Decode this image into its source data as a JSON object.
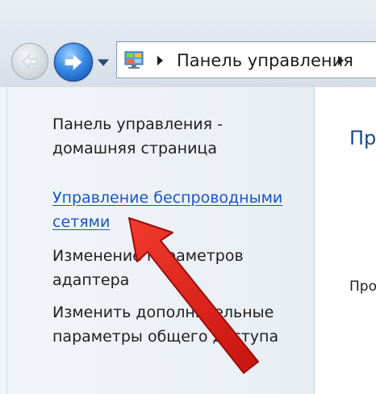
{
  "address_bar": {
    "breadcrumb": "Панель управления",
    "icon": "control-panel-icon"
  },
  "navigation": {
    "back_icon": "back-arrow-icon",
    "forward_icon": "forward-arrow-icon",
    "recent_icon": "chevron-down-icon"
  },
  "sidebar": {
    "items": [
      {
        "lines": [
          "Панель управления -",
          "домашняя страница"
        ]
      },
      {
        "lines": [
          "Управление беспроводными",
          "сетями"
        ],
        "state": "hover"
      },
      {
        "lines": [
          "Изменение параметров",
          "адаптера"
        ]
      },
      {
        "lines": [
          "Изменить дополнительные",
          "параметры общего доступа"
        ]
      }
    ]
  },
  "content": {
    "heading": "Пр",
    "subtext": "Про"
  },
  "colors": {
    "link_hover": "#1a55c8",
    "heading": "#1e4a8a",
    "annotation_arrow": "#e0201c"
  }
}
